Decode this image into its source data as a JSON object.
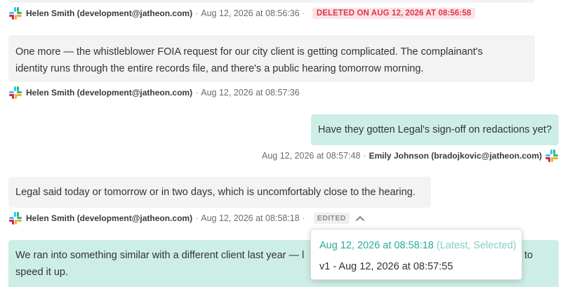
{
  "messages": [
    {
      "sender": "Helen Smith (development@jatheon.com)",
      "timestamp": "Aug 12, 2026 at 08:56:36",
      "separator": "·",
      "badge": "DELETED ON AUG 12, 2026 AT 08:56:58"
    },
    {
      "text": "One more — the whistleblower FOIA request for our city client is getting complicated. The complainant's identity runs through the entire records file, and there's a public hearing tomorrow morning.",
      "sender": "Helen Smith (development@jatheon.com)",
      "timestamp": "Aug 12, 2026 at 08:57:36",
      "separator": "·"
    },
    {
      "text": "Have they gotten Legal's sign-off on redactions yet?",
      "sender": "Emily Johnson (bradojkovic@jatheon.com)",
      "timestamp": "Aug 12, 2026 at 08:57:48",
      "separator": "·"
    },
    {
      "text": "Legal said today or tomorrow or in two days, which is uncomfortably close to the hearing.",
      "sender": "Helen Smith (development@jatheon.com)",
      "timestamp": "Aug 12, 2026 at 08:58:18",
      "separator": "·",
      "badge": "EDITED"
    },
    {
      "text_start": "We ran into something similar with a different client last year — l",
      "text_end": "to",
      "text_line2": "speed it up."
    }
  ],
  "version_popup": {
    "latest": "Aug 12, 2026 at 08:58:18",
    "latest_tag": "(Latest, Selected)",
    "older": "v1 - Aug 12, 2026 at 08:57:55"
  },
  "colors": {
    "incoming_bubble": "#f3f3f3",
    "outgoing_bubble": "#cdeee6",
    "deleted_badge_bg": "#fde3e6",
    "deleted_badge_text": "#d8374a",
    "accent": "#2aaa9c"
  },
  "icons": {
    "sender_avatar": "slack-logo-icon",
    "history_toggle": "chevron-up-icon"
  }
}
